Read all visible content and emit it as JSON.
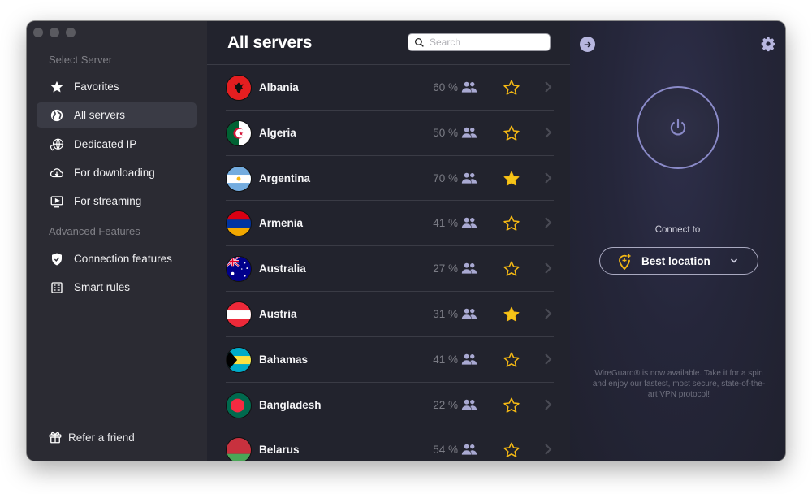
{
  "sidebar": {
    "section_select": "Select Server",
    "items": [
      {
        "label": "Favorites",
        "icon": "star-icon"
      },
      {
        "label": "All servers",
        "icon": "globe-icon",
        "active": true
      },
      {
        "label": "Dedicated IP",
        "icon": "dedicated-ip-icon"
      },
      {
        "label": "For downloading",
        "icon": "cloud-download-icon"
      },
      {
        "label": "For streaming",
        "icon": "streaming-icon"
      }
    ],
    "section_advanced": "Advanced Features",
    "advanced_items": [
      {
        "label": "Connection features",
        "icon": "shield-check-icon"
      },
      {
        "label": "Smart rules",
        "icon": "rules-icon"
      }
    ],
    "refer": "Refer a friend"
  },
  "main": {
    "title": "All servers",
    "search_placeholder": "Search",
    "search_value": "",
    "servers": [
      {
        "country": "Albania",
        "load": "60 %",
        "favorite": false
      },
      {
        "country": "Algeria",
        "load": "50 %",
        "favorite": false
      },
      {
        "country": "Argentina",
        "load": "70 %",
        "favorite": true
      },
      {
        "country": "Armenia",
        "load": "41 %",
        "favorite": false
      },
      {
        "country": "Australia",
        "load": "27 %",
        "favorite": false
      },
      {
        "country": "Austria",
        "load": "31 %",
        "favorite": true
      },
      {
        "country": "Bahamas",
        "load": "41 %",
        "favorite": false
      },
      {
        "country": "Bangladesh",
        "load": "22 %",
        "favorite": false
      },
      {
        "country": "Belarus",
        "load": "54 %",
        "favorite": false
      }
    ]
  },
  "right": {
    "connect_label": "Connect to",
    "location": "Best location",
    "notice": "WireGuard® is now available. Take it for a spin and enjoy our fastest, most secure, state-of-the-art VPN protocol!"
  },
  "colors": {
    "accent_star": "#f5b914",
    "power_ring": "#8a8ac8",
    "pin": "#f5b914"
  }
}
